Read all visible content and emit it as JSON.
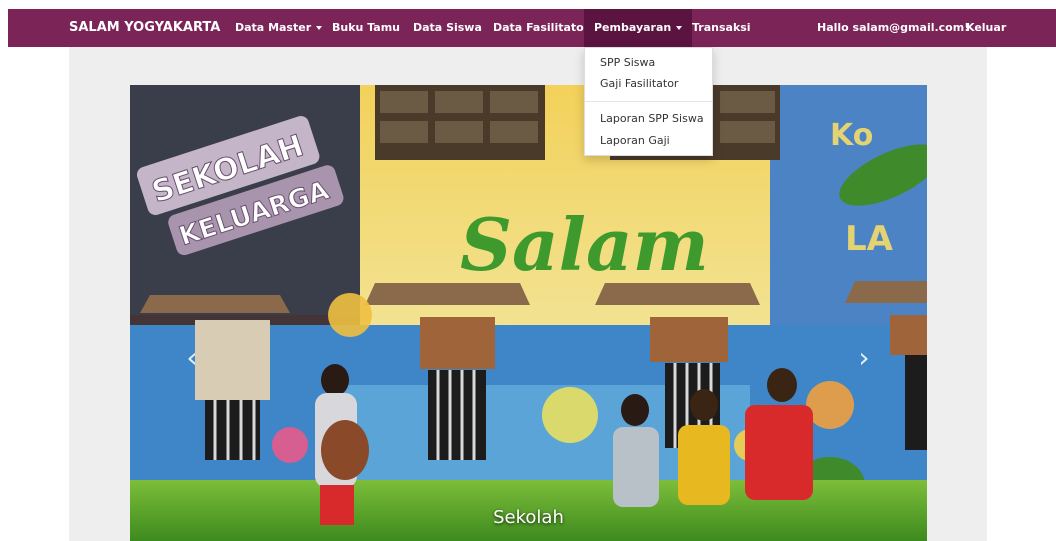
{
  "navbar": {
    "brand": "SALAM YOGYAKARTA",
    "items": [
      {
        "label": "Data Master",
        "has_caret": true
      },
      {
        "label": "Buku Tamu",
        "has_caret": false
      },
      {
        "label": "Data Siswa",
        "has_caret": false
      },
      {
        "label": "Data Fasilitator",
        "has_caret": false
      },
      {
        "label": "Pembayaran",
        "has_caret": true,
        "active": true
      },
      {
        "label": "Transaksi",
        "has_caret": false
      }
    ],
    "user_greeting": "Hallo salam@gmail.com!",
    "logout": "Keluar",
    "colors": {
      "bar": "#7b2458",
      "active": "#5b1440"
    }
  },
  "dropdown": {
    "items": [
      "SPP Siswa",
      "Gaji Fasilitator",
      "Laporan SPP Siswa",
      "Laporan Gaji"
    ]
  },
  "carousel": {
    "caption": "Sekolah",
    "prev_icon": "chevron-left-icon",
    "next_icon": "chevron-right-icon",
    "mural_text": [
      "SEKOLAH",
      "KELUARGA",
      "Salam"
    ]
  }
}
